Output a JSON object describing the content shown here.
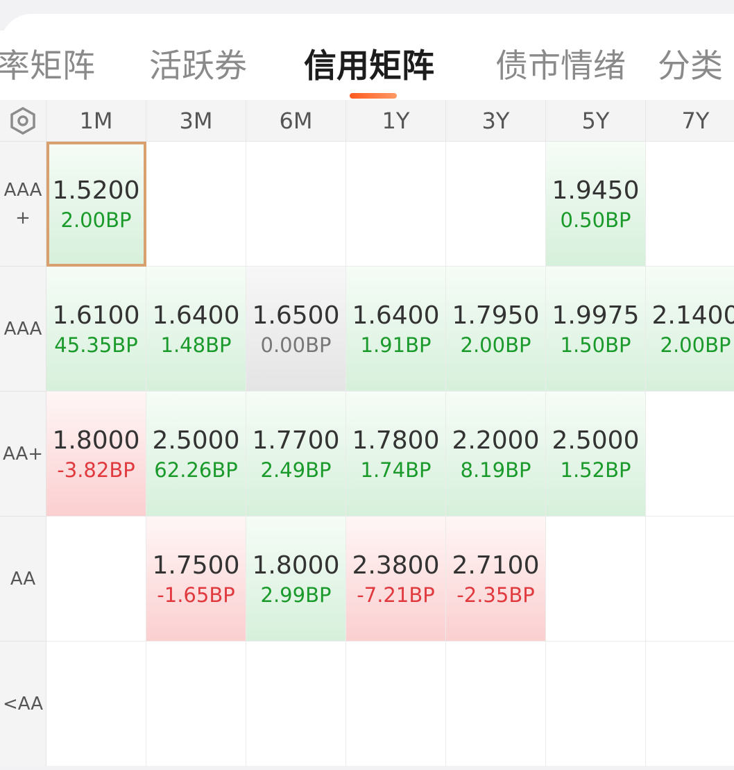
{
  "tabs": [
    {
      "label": "率矩阵",
      "active": false
    },
    {
      "label": "活跃券",
      "active": false
    },
    {
      "label": "信用矩阵",
      "active": true
    },
    {
      "label": "债市情绪",
      "active": false
    },
    {
      "label": "分类",
      "active": false
    }
  ],
  "colors": {
    "up": "#1a9a2a",
    "down": "#e0393e",
    "flat": "#777777",
    "accent": "#ff5a1f",
    "selected_border": "#d8a06e"
  },
  "matrix": {
    "settings_icon": "hexagon-gear-icon",
    "columns": [
      "1M",
      "3M",
      "6M",
      "1Y",
      "3Y",
      "5Y",
      "7Y"
    ],
    "rows": [
      {
        "label": "AAA+",
        "cells": [
          {
            "value": "1.5200",
            "change": "2.00BP",
            "trend": "up",
            "selected": true
          },
          null,
          null,
          null,
          null,
          {
            "value": "1.9450",
            "change": "0.50BP",
            "trend": "up"
          },
          null
        ]
      },
      {
        "label": "AAA",
        "cells": [
          {
            "value": "1.6100",
            "change": "45.35BP",
            "trend": "up"
          },
          {
            "value": "1.6400",
            "change": "1.48BP",
            "trend": "up"
          },
          {
            "value": "1.6500",
            "change": "0.00BP",
            "trend": "flat"
          },
          {
            "value": "1.6400",
            "change": "1.91BP",
            "trend": "up"
          },
          {
            "value": "1.7950",
            "change": "2.00BP",
            "trend": "up"
          },
          {
            "value": "1.9975",
            "change": "1.50BP",
            "trend": "up"
          },
          {
            "value": "2.1400",
            "change": "2.00BP",
            "trend": "up"
          }
        ]
      },
      {
        "label": "AA+",
        "cells": [
          {
            "value": "1.8000",
            "change": "-3.82BP",
            "trend": "down"
          },
          {
            "value": "2.5000",
            "change": "62.26BP",
            "trend": "up"
          },
          {
            "value": "1.7700",
            "change": "2.49BP",
            "trend": "up"
          },
          {
            "value": "1.7800",
            "change": "1.74BP",
            "trend": "up"
          },
          {
            "value": "2.2000",
            "change": "8.19BP",
            "trend": "up"
          },
          {
            "value": "2.5000",
            "change": "1.52BP",
            "trend": "up"
          },
          null
        ]
      },
      {
        "label": "AA",
        "cells": [
          null,
          {
            "value": "1.7500",
            "change": "-1.65BP",
            "trend": "down"
          },
          {
            "value": "1.8000",
            "change": "2.99BP",
            "trend": "up"
          },
          {
            "value": "2.3800",
            "change": "-7.21BP",
            "trend": "down"
          },
          {
            "value": "2.7100",
            "change": "-2.35BP",
            "trend": "down"
          },
          null,
          null
        ]
      },
      {
        "label": "<AA",
        "cells": [
          null,
          null,
          null,
          null,
          null,
          null,
          null
        ]
      }
    ]
  }
}
